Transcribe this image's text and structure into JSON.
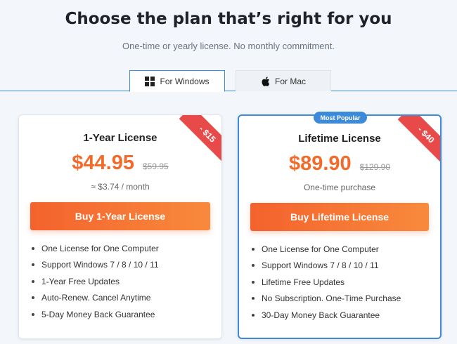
{
  "header": {
    "title": "Choose the plan that’s right for you",
    "subtitle": "One-time or yearly license. No monthly commitment."
  },
  "tabs": [
    {
      "label": "For Windows",
      "icon": "windows-icon",
      "active": true
    },
    {
      "label": "For Mac",
      "icon": "apple-icon",
      "active": false
    }
  ],
  "plans": [
    {
      "name": "1-Year License",
      "price": "$44.95",
      "old_price": "$59.95",
      "note": "≈ $3.74 / month",
      "discount": "- $15",
      "button": "Buy 1-Year License",
      "features": [
        "One License for One Computer",
        "Support Windows 7 / 8 / 10 / 11",
        "1-Year Free Updates",
        "Auto-Renew. Cancel Anytime",
        "5-Day Money Back Guarantee"
      ]
    },
    {
      "name": "Lifetime License",
      "price": "$89.90",
      "old_price": "$129.90",
      "note": "One-time purchase",
      "discount": "- $40",
      "badge": "Most Popular",
      "button": "Buy Lifetime License",
      "features": [
        "One License for One Computer",
        "Support Windows 7 / 8 / 10 / 11",
        "Lifetime Free Updates",
        "No Subscription. One-Time Purchase",
        "30-Day Money Back Guarantee"
      ]
    }
  ],
  "colors": {
    "accent_orange": "#f26b2a",
    "accent_blue": "#3d8bd8",
    "ribbon_red": "#e84a4a"
  }
}
